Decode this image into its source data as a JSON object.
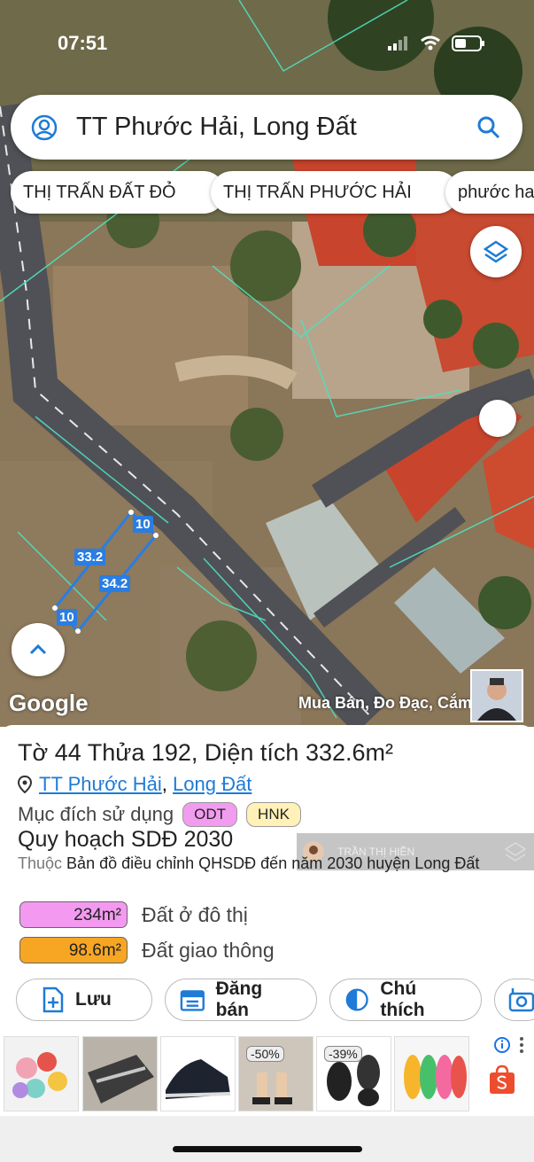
{
  "status": {
    "time": "07:51"
  },
  "search": {
    "query": "TT Phước Hải, Long Đất"
  },
  "chips": [
    "THỊ TRẤN ĐẤT ĐỎ",
    "THỊ TRẤN PHƯỚC HẢI",
    "phước ha"
  ],
  "map": {
    "edge_labels": [
      "10",
      "33.2",
      "34.2",
      "10"
    ],
    "google_logo": "Google",
    "attribution": "Mua Bán, Đo Đạc, Cắm"
  },
  "parcel": {
    "title": "Tờ 44 Thửa 192, Diện tích 332.6m²",
    "location_a": "TT Phước Hải",
    "location_sep": ",",
    "location_b": "Long Đất",
    "purpose_label": "Mục đích sử dụng",
    "tags": [
      {
        "label": "ODT",
        "color": "#f29cf0"
      },
      {
        "label": "HNK",
        "color": "#fff1b8"
      }
    ],
    "plan_title": "Quy hoạch SDĐ 2030",
    "belongs_prefix": "Thuộc",
    "belongs_text": "Bản đồ điều chỉnh QHSDĐ đến năm 2030 huyện Long Đất",
    "overlay_name": "TRẦN THỊ HIỀN",
    "areas": [
      {
        "value": "234m²",
        "name": "Đất ở đô thị",
        "color": "#f39af0"
      },
      {
        "value": "98.6m²",
        "name": "Đất giao thông",
        "color": "#f6a623"
      }
    ]
  },
  "actions": [
    "Lưu",
    "Đăng bán",
    "Chú thích"
  ],
  "ads": {
    "discounts": [
      "-50%",
      "-39%"
    ]
  },
  "colors": {
    "accent": "#1f7bd6",
    "parcel_line": "#2a7de1"
  }
}
